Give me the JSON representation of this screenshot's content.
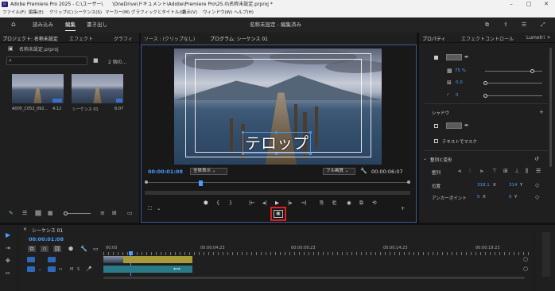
{
  "window": {
    "title": "Adobe Premiere Pro 2025 - C:\\ユーザー\\　　\\OneDrive\\ドキュメント\\Adobe\\Premiere Pro\\25.0\\名称未設定.prproj *",
    "app_icon": "Pr"
  },
  "menu": [
    "ファイル(F)",
    "編集(E)",
    "クリップ(C)",
    "シーケンス(S)",
    "マーカー(M)",
    "グラフィックとタイトル(G)",
    "表示(V)",
    "ウィンドウ(W)",
    "ヘルプ(H)"
  ],
  "workspace": {
    "tabs": [
      "読み込み",
      "編集",
      "書き出し"
    ],
    "active": "編集",
    "center_title": "名称未設定 - 編集済み"
  },
  "project": {
    "tabs": [
      "プロジェクト: 名称未設定",
      "エフェクト",
      "グラフィ"
    ],
    "file": "名称未設定.prproj",
    "items_count": "2 個の...",
    "items": [
      {
        "name": "A005_C052_092...",
        "duration": "4:12"
      },
      {
        "name": "シーケンス 01",
        "duration": "6:07"
      }
    ]
  },
  "monitor": {
    "source_tab": "ソース : (クリップなし)",
    "program_tab": "プログラム: シーケンス 01",
    "current_time": "00:00:01:08",
    "fit": "全体表示",
    "quality": "フル画質",
    "duration": "00:00:06:07",
    "telop": "テロップ"
  },
  "properties": {
    "tabs": [
      "プロパティ",
      "エフェクトコントロール",
      "Lumetri"
    ],
    "opacity": "75 %",
    "stroke": "0.0",
    "corner": "0",
    "shadow_label": "シャドウ",
    "mask_label": "テキストでマスク",
    "align_section": "整列と変形",
    "align_label": "整列",
    "position_label": "位置",
    "position_x": "318.1",
    "position_y": "314",
    "anchor_label": "アンカーポイント",
    "anchor_x": "0",
    "anchor_y": "0"
  },
  "timeline": {
    "tab": "シーケンス 01",
    "current_time": "00:00:01:08",
    "ruler": [
      "00:00",
      "00:00:04:23",
      "00:00:09:23",
      "00:00:14:23",
      "00:00:19:23"
    ]
  },
  "colors": {
    "accent": "#4a9eff",
    "highlight": "#e02020"
  }
}
